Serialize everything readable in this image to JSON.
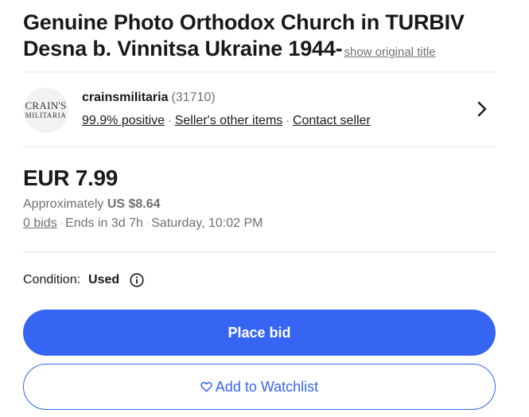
{
  "listing": {
    "title": "Genuine Photo Orthodox Church in TURBIV Desna b. Vinnitsa Ukraine 1944-",
    "show_original_title": "show original title"
  },
  "seller": {
    "logo_line1": "CRAIN'S",
    "logo_line2": "MILITARIA",
    "name": "crainsmilitaria",
    "feedback_count": "(31710)",
    "positive": "99.9% positive",
    "other_items": "Seller's other items",
    "contact": "Contact seller",
    "separator": "·"
  },
  "pricing": {
    "price": "EUR 7.99",
    "approx_prefix": "Approximately ",
    "approx_value": "US $8.64",
    "bids": "0 bids",
    "ends_in": "Ends in 3d 7h",
    "end_time": "Saturday, 10:02 PM",
    "separator": "·"
  },
  "condition": {
    "label": "Condition:",
    "value": "Used"
  },
  "actions": {
    "place_bid": "Place bid",
    "watchlist": "Add to Watchlist"
  },
  "colors": {
    "accent": "#3665f3",
    "text": "#191919",
    "secondary_text": "#707070"
  },
  "icons": {
    "seller_chevron": "chevron-right-icon",
    "condition_info": "info-icon",
    "watchlist": "heart-outline-icon"
  }
}
